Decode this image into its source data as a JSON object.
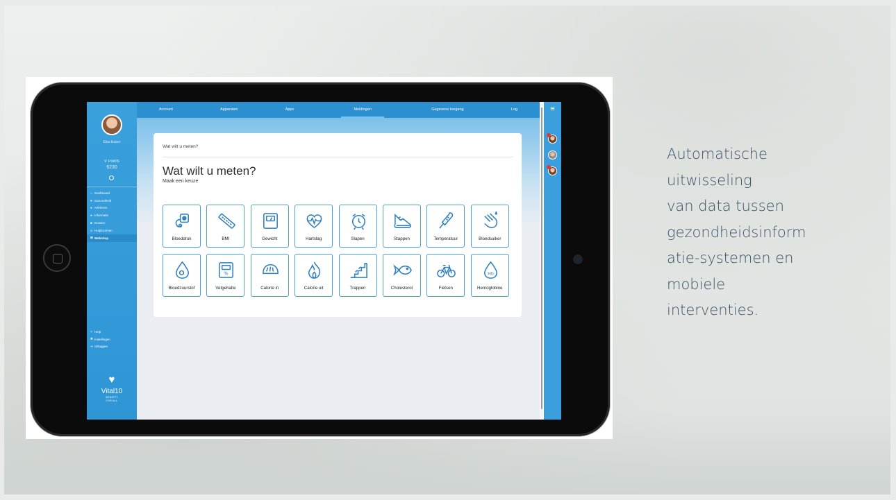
{
  "slide": {
    "text_lines": [
      "Automatische",
      "uitwisseling",
      "van data tussen",
      "gezondheidsinform",
      "atie-systemen en",
      "mobiele",
      "interventies."
    ]
  },
  "app": {
    "user": {
      "name": "Elise Keizer",
      "points_label": "V Points",
      "points_value": "6230"
    },
    "nav_items": [
      {
        "label": "Dashboard",
        "icon": "home-icon"
      },
      {
        "label": "Gezondheid",
        "icon": "heart-icon"
      },
      {
        "label": "Adviezen",
        "icon": "user-icon"
      },
      {
        "label": "Informatie",
        "icon": "info-icon"
      },
      {
        "label": "Dossier",
        "icon": "folder-icon"
      },
      {
        "label": "Hulpbronnen",
        "icon": "link-icon"
      },
      {
        "label": "Webshop",
        "icon": "cart-icon",
        "active": true
      }
    ],
    "nav_bottom": [
      {
        "label": "Help",
        "icon": "question-icon"
      },
      {
        "label": "Instellingen",
        "icon": "gear-icon"
      },
      {
        "label": "Uitloggen",
        "icon": "logout-icon"
      }
    ],
    "brand": {
      "name": "Vital10",
      "sub": "BENEFIT",
      "sub2": "FOR ALL"
    },
    "tabs": [
      "Account",
      "Apparaten",
      "Apps",
      "Meldingen",
      "Gegevens toegang",
      "Log"
    ],
    "active_tab": "Meldingen",
    "card": {
      "breadcrumb": "Wat wilt u meten?",
      "title": "Wat wilt u meten?",
      "subtitle": "Maak een keuze"
    },
    "tiles": [
      {
        "label": "Bloeddruk",
        "icon": "blood-pressure-icon"
      },
      {
        "label": "BMI",
        "icon": "ruler-icon"
      },
      {
        "label": "Gewicht",
        "icon": "scale-icon"
      },
      {
        "label": "Hartslag",
        "icon": "heartbeat-icon"
      },
      {
        "label": "Slapen",
        "icon": "alarm-clock-icon"
      },
      {
        "label": "Stappen",
        "icon": "shoe-icon"
      },
      {
        "label": "Temperatuur",
        "icon": "thermometer-icon"
      },
      {
        "label": "Bloedsuiker",
        "icon": "finger-prick-icon"
      },
      {
        "label": "Bloedzuurstof",
        "icon": "drop-icon"
      },
      {
        "label": "Vetgehalte",
        "icon": "body-fat-scale-icon"
      },
      {
        "label": "Calorie in",
        "icon": "bread-icon"
      },
      {
        "label": "Calorie uit",
        "icon": "flame-icon"
      },
      {
        "label": "Trappen",
        "icon": "stairs-icon"
      },
      {
        "label": "Cholesterol",
        "icon": "fish-icon"
      },
      {
        "label": "Fietsen",
        "icon": "bicycle-icon"
      },
      {
        "label": "Hemoglobine",
        "icon": "hemoglobin-drop-icon"
      }
    ],
    "accent_color": "#2f96d6",
    "icon_color": "#2f7fc1"
  }
}
